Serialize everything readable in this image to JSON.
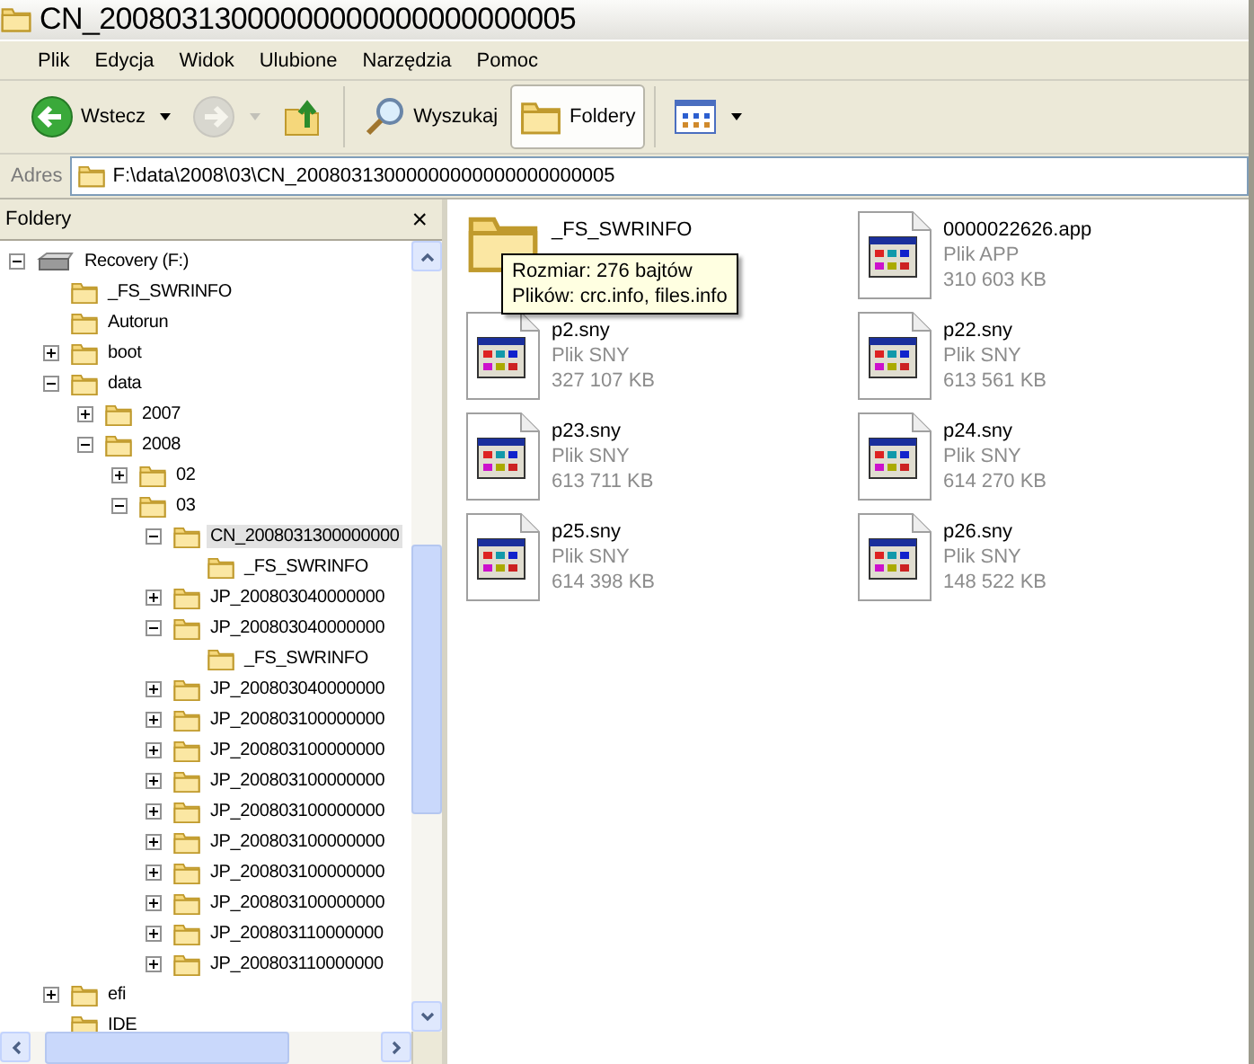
{
  "window": {
    "title": "CN_20080313000000000000000000005"
  },
  "menu": [
    "Plik",
    "Edycja",
    "Widok",
    "Ulubione",
    "Narzędzia",
    "Pomoc"
  ],
  "toolbar": [
    {
      "kind": "back",
      "label": "Wstecz",
      "disabled": false,
      "selected": false
    },
    {
      "kind": "forward",
      "disabled": true,
      "selected": false
    },
    {
      "kind": "up",
      "disabled": false,
      "selected": false
    },
    {
      "kind": "search",
      "label": "Wyszukaj",
      "disabled": false,
      "selected": false
    },
    {
      "kind": "folders",
      "label": "Foldery",
      "disabled": false,
      "selected": true
    },
    {
      "kind": "views",
      "disabled": false,
      "selected": false
    }
  ],
  "address": {
    "label": "Adres",
    "value": "F:\\data\\2008\\03\\CN_20080313000000000000000000005"
  },
  "folder_pane": {
    "title": "Foldery",
    "close": "×"
  },
  "tree": [
    {
      "name": "Recovery (F:)",
      "kind": "drive",
      "expanded": true,
      "selected": false,
      "children": [
        {
          "name": "_FS_SWRINFO",
          "kind": "plain-folder",
          "selected": false
        },
        {
          "name": "Autorun",
          "kind": "plain-folder",
          "selected": false
        },
        {
          "name": "boot",
          "kind": "folder",
          "expanded": false,
          "selected": false
        },
        {
          "name": "data",
          "kind": "folder",
          "expanded": true,
          "selected": false,
          "children": [
            {
              "name": "2007",
              "kind": "folder",
              "expanded": false,
              "selected": false
            },
            {
              "name": "2008",
              "kind": "folder",
              "expanded": true,
              "selected": false,
              "children": [
                {
                  "name": "02",
                  "kind": "folder",
                  "expanded": false,
                  "selected": false
                },
                {
                  "name": "03",
                  "kind": "folder",
                  "expanded": true,
                  "selected": false,
                  "children": [
                    {
                      "name": "CN_2008031300000000",
                      "kind": "folder",
                      "expanded": true,
                      "selected": true,
                      "children": [
                        {
                          "name": "_FS_SWRINFO",
                          "kind": "plain-folder",
                          "selected": false
                        }
                      ]
                    },
                    {
                      "name": "JP_200803040000000",
                      "kind": "folder",
                      "expanded": false,
                      "selected": false
                    },
                    {
                      "name": "JP_200803040000000",
                      "kind": "folder",
                      "expanded": true,
                      "selected": false,
                      "children": [
                        {
                          "name": "_FS_SWRINFO",
                          "kind": "plain-folder",
                          "selected": false
                        }
                      ]
                    },
                    {
                      "name": "JP_200803040000000",
                      "kind": "folder",
                      "expanded": false,
                      "selected": false
                    },
                    {
                      "name": "JP_200803100000000",
                      "kind": "folder",
                      "expanded": false,
                      "selected": false
                    },
                    {
                      "name": "JP_200803100000000",
                      "kind": "folder",
                      "expanded": false,
                      "selected": false
                    },
                    {
                      "name": "JP_200803100000000",
                      "kind": "folder",
                      "expanded": false,
                      "selected": false
                    },
                    {
                      "name": "JP_200803100000000",
                      "kind": "folder",
                      "expanded": false,
                      "selected": false
                    },
                    {
                      "name": "JP_200803100000000",
                      "kind": "folder",
                      "expanded": false,
                      "selected": false
                    },
                    {
                      "name": "JP_200803100000000",
                      "kind": "folder",
                      "expanded": false,
                      "selected": false
                    },
                    {
                      "name": "JP_200803100000000",
                      "kind": "folder",
                      "expanded": false,
                      "selected": false
                    },
                    {
                      "name": "JP_200803110000000",
                      "kind": "folder",
                      "expanded": false,
                      "selected": false
                    },
                    {
                      "name": "JP_200803110000000",
                      "kind": "folder",
                      "expanded": false,
                      "selected": false
                    }
                  ]
                }
              ]
            }
          ]
        },
        {
          "name": "efi",
          "kind": "folder",
          "expanded": false,
          "selected": false
        },
        {
          "name": "IDE",
          "kind": "plain-folder",
          "selected": false
        }
      ]
    }
  ],
  "files": [
    {
      "kind": "folder",
      "name": "_FS_SWRINFO"
    },
    {
      "kind": "file",
      "name": "0000022626.app",
      "type": "Plik APP",
      "size": "310 603 KB"
    },
    {
      "kind": "file",
      "name": "p2.sny",
      "type": "Plik SNY",
      "size": "327 107 KB"
    },
    {
      "kind": "file",
      "name": "p22.sny",
      "type": "Plik SNY",
      "size": "613 561 KB"
    },
    {
      "kind": "file",
      "name": "p23.sny",
      "type": "Plik SNY",
      "size": "613 711 KB"
    },
    {
      "kind": "file",
      "name": "p24.sny",
      "type": "Plik SNY",
      "size": "614 270 KB"
    },
    {
      "kind": "file",
      "name": "p25.sny",
      "type": "Plik SNY",
      "size": "614 398 KB"
    },
    {
      "kind": "file",
      "name": "p26.sny",
      "type": "Plik SNY",
      "size": "148 522 KB"
    }
  ],
  "tooltip": {
    "lines": [
      "Rozmiar: 276 bajtów",
      "Plików: crc.info, files.info"
    ]
  }
}
